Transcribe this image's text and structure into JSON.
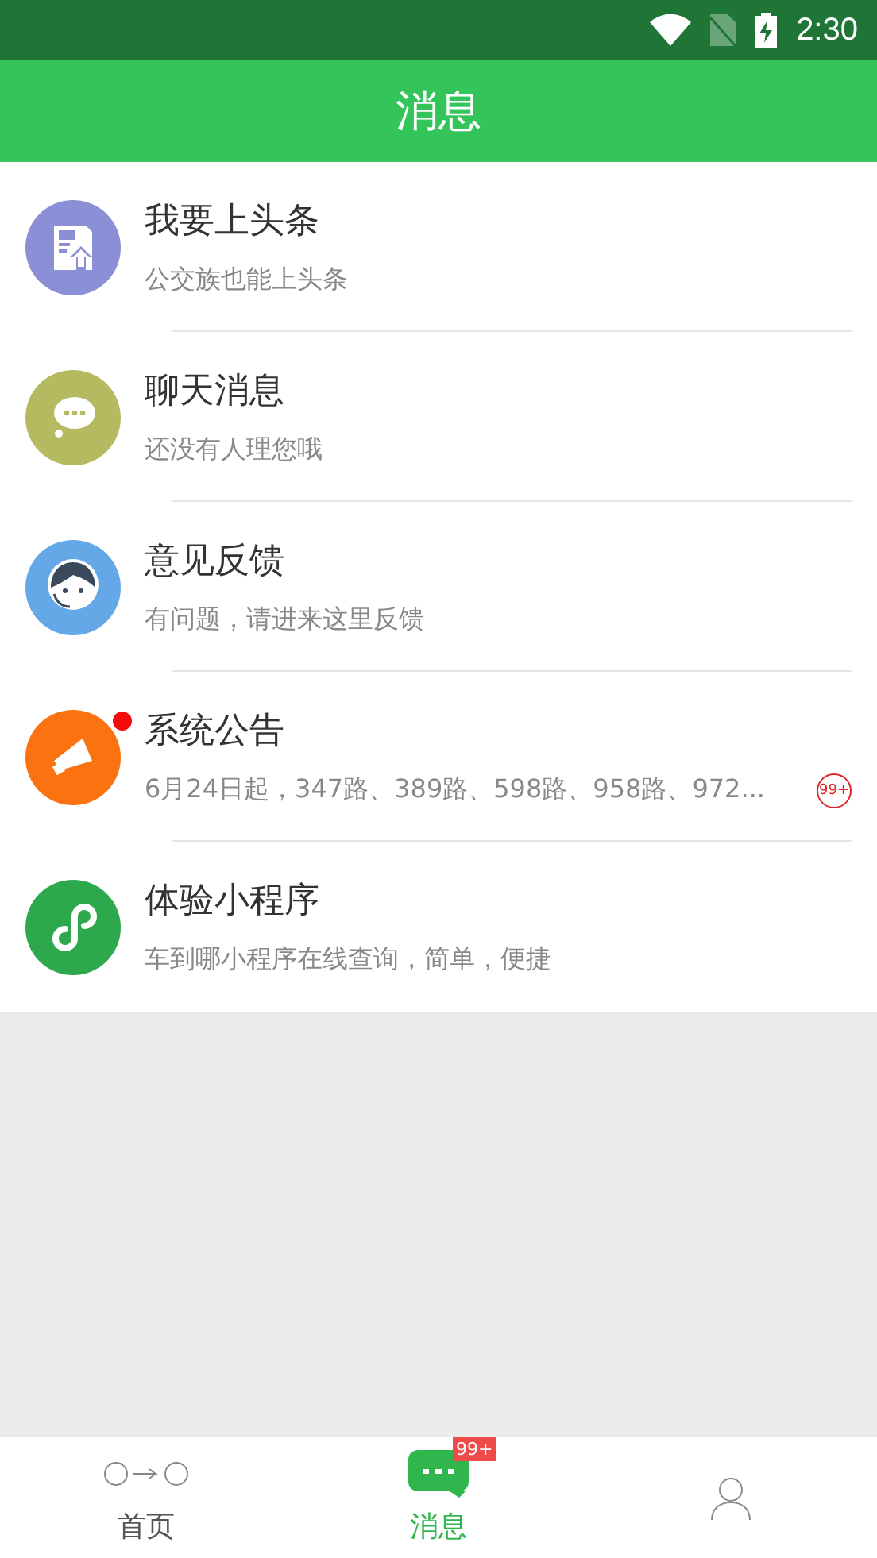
{
  "status_bar": {
    "time": "2:30"
  },
  "header": {
    "title": "消息"
  },
  "messages": [
    {
      "kind": "headline",
      "title": "我要上头条",
      "subtitle": "公交族也能上头条",
      "color": "#8b8fd6",
      "dot": false
    },
    {
      "kind": "chat",
      "title": "聊天消息",
      "subtitle": "还没有人理您哦",
      "color": "#b5b960",
      "dot": false
    },
    {
      "kind": "feedback",
      "title": "意见反馈",
      "subtitle": "有问题，请进来这里反馈",
      "color": "#64a8e8",
      "dot": false
    },
    {
      "kind": "notice",
      "title": "系统公告",
      "subtitle": "6月24日起，347路、389路、598路、958路、972...",
      "color": "#fb7211",
      "dot": true,
      "badge": "99+"
    },
    {
      "kind": "miniapp",
      "title": "体验小程序",
      "subtitle": "车到哪小程序在线查询，简单，便捷",
      "color": "#2ea84d",
      "dot": false
    }
  ],
  "tabs": [
    {
      "kind": "home",
      "label": "首页",
      "selected": false
    },
    {
      "kind": "messages",
      "label": "消息",
      "selected": true,
      "badge": "99+"
    },
    {
      "kind": "me",
      "selected": false
    }
  ]
}
